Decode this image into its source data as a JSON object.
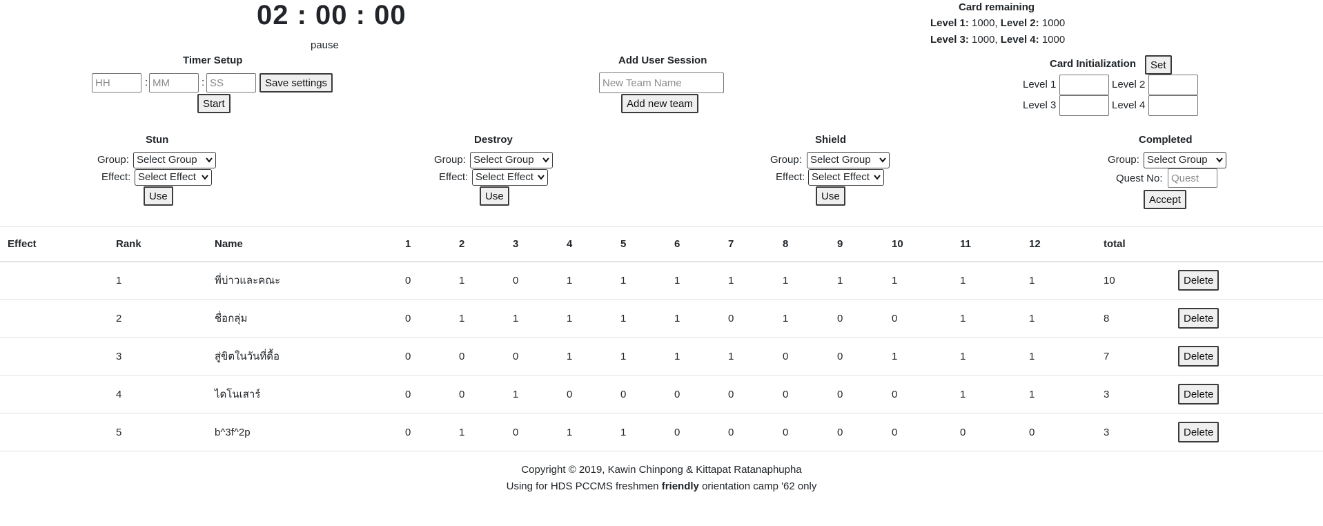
{
  "timer": {
    "display": "02 : 00 : 00",
    "status": "pause"
  },
  "card_remaining": {
    "title": "Card remaining",
    "levels": [
      {
        "label": "Level 1:",
        "value": "1000"
      },
      {
        "label": "Level 2:",
        "value": "1000"
      },
      {
        "label": "Level 3:",
        "value": "1000"
      },
      {
        "label": "Level 4:",
        "value": "1000"
      }
    ],
    "sep": ","
  },
  "timer_setup": {
    "title": "Timer Setup",
    "hh_placeholder": "HH",
    "mm_placeholder": "MM",
    "ss_placeholder": "SS",
    "colon": ":",
    "save_label": "Save settings",
    "start_label": "Start"
  },
  "user_session": {
    "title": "Add User Session",
    "team_placeholder": "New Team Name",
    "add_label": "Add new team"
  },
  "card_init": {
    "title": "Card Initialization",
    "set_label": "Set",
    "level_labels": [
      "Level 1",
      "Level 2",
      "Level 3",
      "Level 4"
    ]
  },
  "actions": {
    "group_label": "Group:",
    "effect_label": "Effect:",
    "group_selected": "Select Group",
    "effect_selected": "Select Effect",
    "use_label": "Use",
    "stun_title": "Stun",
    "destroy_title": "Destroy",
    "shield_title": "Shield",
    "completed": {
      "title": "Completed",
      "quest_label": "Quest No:",
      "quest_placeholder": "Quest",
      "accept_label": "Accept"
    }
  },
  "table": {
    "headers": [
      "Effect",
      "Rank",
      "Name",
      "1",
      "2",
      "3",
      "4",
      "5",
      "6",
      "7",
      "8",
      "9",
      "10",
      "11",
      "12",
      "total"
    ],
    "delete_label": "Delete",
    "rows": [
      {
        "effect": "",
        "rank": "1",
        "name": "พี่บ่าวและคณะ",
        "scores": [
          "0",
          "1",
          "0",
          "1",
          "1",
          "1",
          "1",
          "1",
          "1",
          "1",
          "1",
          "1"
        ],
        "total": "10"
      },
      {
        "effect": "",
        "rank": "2",
        "name": "ชื่อกลุ่ม",
        "scores": [
          "0",
          "1",
          "1",
          "1",
          "1",
          "1",
          "0",
          "1",
          "0",
          "0",
          "1",
          "1"
        ],
        "total": "8"
      },
      {
        "effect": "",
        "rank": "3",
        "name": "สู่ขิตในวันที่ดื้อ",
        "scores": [
          "0",
          "0",
          "0",
          "1",
          "1",
          "1",
          "1",
          "0",
          "0",
          "1",
          "1",
          "1"
        ],
        "total": "7"
      },
      {
        "effect": "",
        "rank": "4",
        "name": "ไดโนเสาร์",
        "scores": [
          "0",
          "0",
          "1",
          "0",
          "0",
          "0",
          "0",
          "0",
          "0",
          "0",
          "1",
          "1"
        ],
        "total": "3"
      },
      {
        "effect": "",
        "rank": "5",
        "name": "b^3f^2p",
        "scores": [
          "0",
          "1",
          "0",
          "1",
          "1",
          "0",
          "0",
          "0",
          "0",
          "0",
          "0",
          "0"
        ],
        "total": "3"
      }
    ]
  },
  "footer": {
    "copyright": "Copyright © 2019, Kawin Chinpong & Kittapat Ratanaphupha",
    "line2_prefix": "Using for HDS PCCMS freshmen",
    "line2_bold": "friendly",
    "line2_suffix": "orientation camp '62 only"
  }
}
